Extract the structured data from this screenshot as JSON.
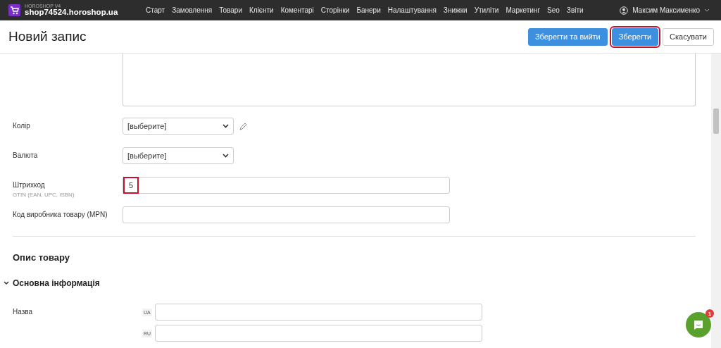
{
  "brand": {
    "caption": "HOROSHOP V4",
    "domain": "shop74524.horoshop.ua"
  },
  "nav": [
    "Старт",
    "Замовлення",
    "Товари",
    "Клієнти",
    "Коментарі",
    "Сторінки",
    "Банери",
    "Налаштування",
    "Знижки",
    "Утиліти",
    "Маркетинг",
    "Seo",
    "Звіти"
  ],
  "user": {
    "name": "Максим Максименко"
  },
  "page_title": "Новий запис",
  "buttons": [
    {
      "label": "Зберегти та вийти",
      "kind": "primary",
      "highlighted": false
    },
    {
      "label": "Зберегти",
      "kind": "primary",
      "highlighted": true
    },
    {
      "label": "Скасувати",
      "kind": "default",
      "highlighted": false
    }
  ],
  "fields": [
    {
      "kind": "select",
      "label": "Колір",
      "value": "[выберите]",
      "editable": true
    },
    {
      "kind": "select",
      "label": "Валюта",
      "value": "[выберите]"
    },
    {
      "kind": "input",
      "label": "Штрихкод",
      "hint": "GTIN (EAN, UPC, ISBN)",
      "value": "5",
      "highlighted": true
    },
    {
      "kind": "input",
      "label": "Код виробника товару (MPN)"
    }
  ],
  "section_title": "Опис товару",
  "group": {
    "title": "Основна інформація",
    "expanded": true,
    "fields": [
      {
        "label": "Назва",
        "langs": [
          "UA",
          "RU"
        ]
      }
    ]
  },
  "chat": {
    "badge": "1"
  }
}
